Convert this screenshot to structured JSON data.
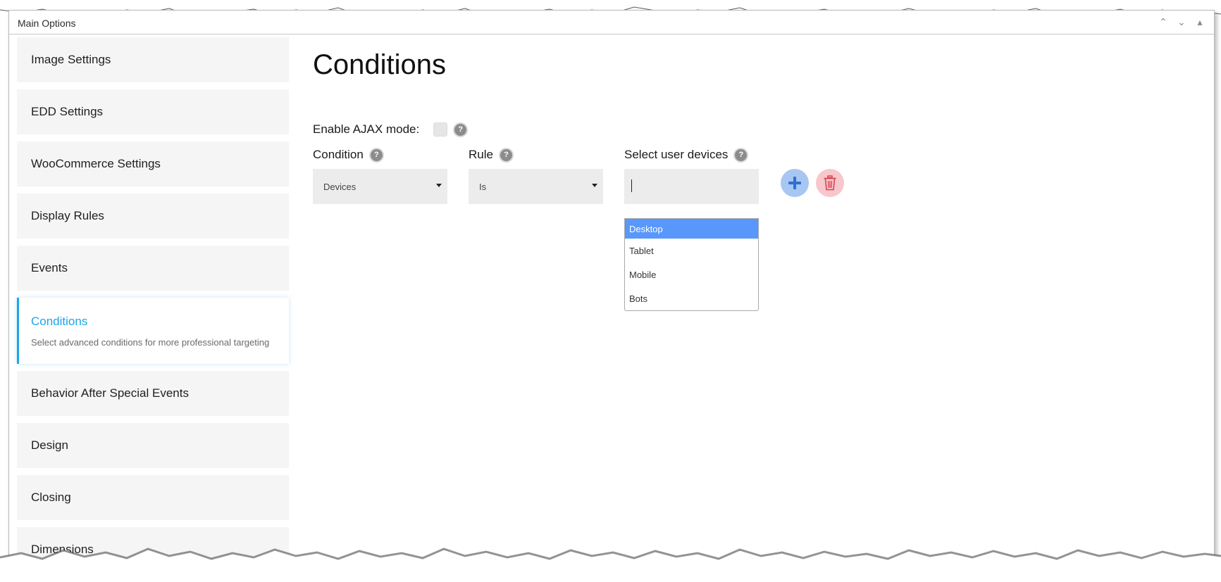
{
  "panel": {
    "title": "Main Options",
    "controls": [
      "⌃",
      "⌄",
      "▴"
    ]
  },
  "sidebar": {
    "items": [
      {
        "label": "Image Settings"
      },
      {
        "label": "EDD Settings"
      },
      {
        "label": "WooCommerce Settings"
      },
      {
        "label": "Display Rules"
      },
      {
        "label": "Events"
      },
      {
        "label": "Conditions",
        "description": "Select advanced conditions for more professional targeting",
        "active": true
      },
      {
        "label": "Behavior After Special Events"
      },
      {
        "label": "Design"
      },
      {
        "label": "Closing"
      },
      {
        "label": "Dimensions"
      }
    ]
  },
  "main": {
    "title": "Conditions",
    "ajax_label": "Enable AJAX mode:",
    "help_glyph": "?",
    "condition": {
      "label": "Condition",
      "value": "Devices"
    },
    "rule": {
      "label": "Rule",
      "value": "Is"
    },
    "devices": {
      "label": "Select user devices",
      "input_value": "",
      "options": [
        "Desktop",
        "Tablet",
        "Mobile",
        "Bots"
      ],
      "highlighted": "Desktop"
    },
    "add_icon": "plus-icon",
    "delete_icon": "trash-icon"
  },
  "colors": {
    "accent": "#1aa6e8",
    "sidebar_bg": "#f5f5f5",
    "select_bg": "#ececec",
    "option_highlight": "#5897fb",
    "add_button": "#a8c6f2",
    "add_icon": "#2f6fd1",
    "delete_button": "#f7c7cc",
    "delete_icon": "#d9434f"
  }
}
